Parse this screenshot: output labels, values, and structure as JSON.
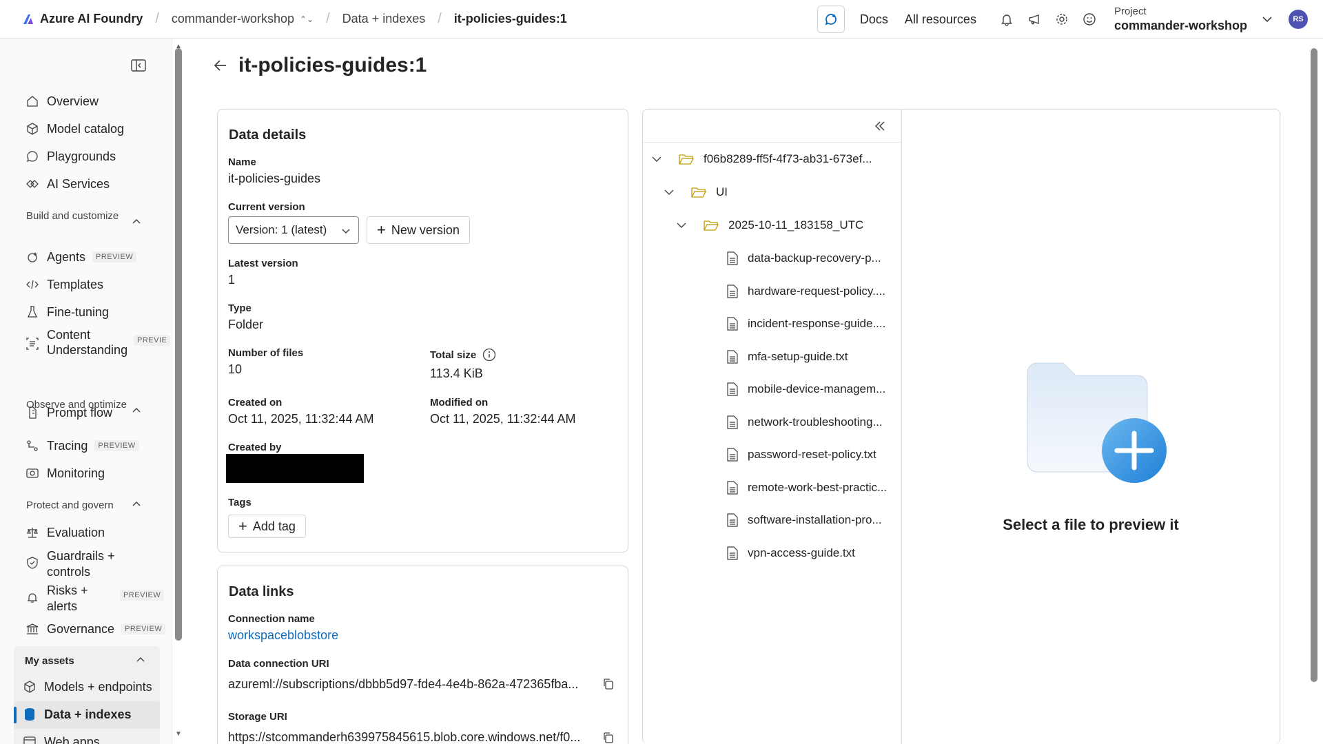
{
  "topbar": {
    "brand": "Azure AI Foundry",
    "project_switcher": "commander-workshop",
    "breadcrumb_data": "Data + indexes",
    "breadcrumb_current": "it-policies-guides:1",
    "docs": "Docs",
    "all_resources": "All resources",
    "project_label": "Project",
    "project_name": "commander-workshop",
    "avatar_initials": "RS"
  },
  "sidebar": {
    "overview": "Overview",
    "model_catalog": "Model catalog",
    "playgrounds": "Playgrounds",
    "ai_services": "AI Services",
    "group_build": "Build and customize",
    "agents": "Agents",
    "templates": "Templates",
    "fine_tuning": "Fine-tuning",
    "content_understanding": "Content Understanding",
    "prompt_flow": "Prompt flow",
    "group_observe": "Observe and optimize",
    "tracing": "Tracing",
    "monitoring": "Monitoring",
    "group_protect": "Protect and govern",
    "evaluation": "Evaluation",
    "guardrails": "Guardrails + controls",
    "risks": "Risks + alerts",
    "governance": "Governance",
    "group_assets": "My assets",
    "models_endpoints": "Models + endpoints",
    "data_indexes": "Data + indexes",
    "web_apps": "Web apps",
    "badge_preview": "PREVIEW",
    "badge_previe": "PREVIE"
  },
  "page": {
    "title": "it-policies-guides:1"
  },
  "details": {
    "title": "Data details",
    "name_label": "Name",
    "name_value": "it-policies-guides",
    "current_version_label": "Current version",
    "version_select": "Version: 1 (latest)",
    "new_version_btn": "New version",
    "latest_version_label": "Latest version",
    "latest_version_value": "1",
    "type_label": "Type",
    "type_value": "Folder",
    "num_files_label": "Number of files",
    "num_files_value": "10",
    "total_size_label": "Total size",
    "total_size_value": "113.4 KiB",
    "created_on_label": "Created on",
    "created_on_value": "Oct 11, 2025, 11:32:44 AM",
    "modified_on_label": "Modified on",
    "modified_on_value": "Oct 11, 2025, 11:32:44 AM",
    "created_by_label": "Created by",
    "tags_label": "Tags",
    "add_tag_btn": "Add tag"
  },
  "links": {
    "title": "Data links",
    "connection_label": "Connection name",
    "connection_value": "workspaceblobstore",
    "uri_label": "Data connection URI",
    "uri_value": "azureml://subscriptions/dbbb5d97-fde4-4e4b-862a-472365fba...",
    "storage_label": "Storage URI",
    "storage_value": "https://stcommanderh639975845615.blob.core.windows.net/f0..."
  },
  "tree": {
    "root": "f06b8289-ff5f-4f73-ab31-673ef...",
    "ui": "UI",
    "dated": "2025-10-11_183158_UTC",
    "files": [
      "data-backup-recovery-p...",
      "hardware-request-policy....",
      "incident-response-guide....",
      "mfa-setup-guide.txt",
      "mobile-device-managem...",
      "network-troubleshooting...",
      "password-reset-policy.txt",
      "remote-work-best-practic...",
      "software-installation-pro...",
      "vpn-access-guide.txt"
    ]
  },
  "preview": {
    "empty_text": "Select a file to preview it"
  }
}
